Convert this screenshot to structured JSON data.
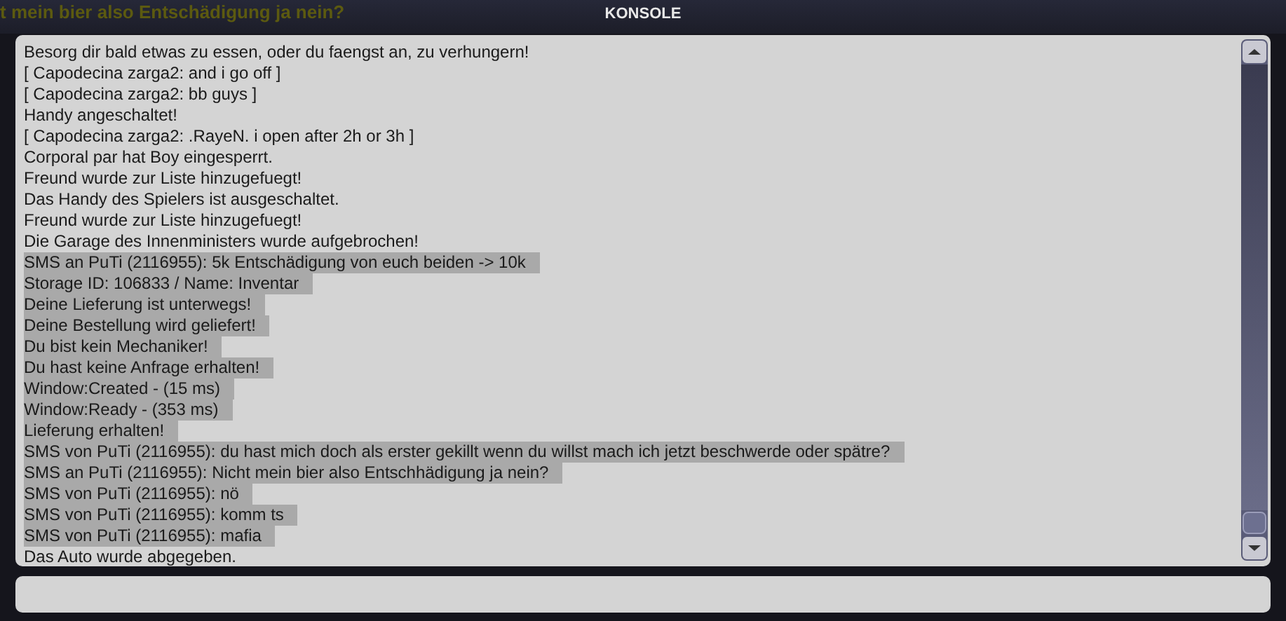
{
  "background_chat": "t mein bier also Entschädigung ja nein?",
  "window": {
    "title": "KONSOLE"
  },
  "log": [
    {
      "text": "Besorg dir bald etwas zu essen, oder du faengst an, zu verhungern!",
      "selected": false
    },
    {
      "text": "[ Capodecina zarga2: and i go off ]",
      "selected": false
    },
    {
      "text": "[ Capodecina zarga2: bb guys ]",
      "selected": false
    },
    {
      "text": "Handy angeschaltet!",
      "selected": false
    },
    {
      "text": "[ Capodecina zarga2: .RayeN. i open after 2h or 3h ]",
      "selected": false
    },
    {
      "text": "Corporal par hat Boy eingesperrt.",
      "selected": false
    },
    {
      "text": "Freund wurde zur Liste hinzugefuegt!",
      "selected": false
    },
    {
      "text": "Das Handy des Spielers ist ausgeschaltet.",
      "selected": false
    },
    {
      "text": "Freund wurde zur Liste hinzugefuegt!",
      "selected": false
    },
    {
      "text": "Die Garage des Innenministers wurde aufgebrochen!",
      "selected": false
    },
    {
      "text": "SMS an PuTi (2116955): 5k Entschädigung von euch beiden -> 10k",
      "selected": true
    },
    {
      "text": "Storage ID: 106833 / Name: Inventar",
      "selected": true
    },
    {
      "text": "Deine Lieferung ist unterwegs!",
      "selected": true
    },
    {
      "text": "Deine Bestellung wird geliefert!",
      "selected": true
    },
    {
      "text": "Du bist kein Mechaniker!",
      "selected": true
    },
    {
      "text": "Du hast keine Anfrage erhalten!",
      "selected": true
    },
    {
      "text": "Window:Created - (15 ms)",
      "selected": true
    },
    {
      "text": "Window:Ready - (353 ms)",
      "selected": true
    },
    {
      "text": "Lieferung erhalten!",
      "selected": true
    },
    {
      "text": "SMS von PuTi (2116955): du hast mich doch als erster gekillt wenn du willst mach ich jetzt beschwerde oder spätre?",
      "selected": true
    },
    {
      "text": "SMS an PuTi (2116955): Nicht mein bier also Entschhädigung ja nein?",
      "selected": true
    },
    {
      "text": "SMS von PuTi (2116955): nö",
      "selected": true
    },
    {
      "text": "SMS von PuTi (2116955): komm ts",
      "selected": true
    },
    {
      "text": "SMS von PuTi (2116955): mafia",
      "selected": true
    },
    {
      "text": "Das Auto wurde abgegeben.",
      "selected": false
    }
  ]
}
